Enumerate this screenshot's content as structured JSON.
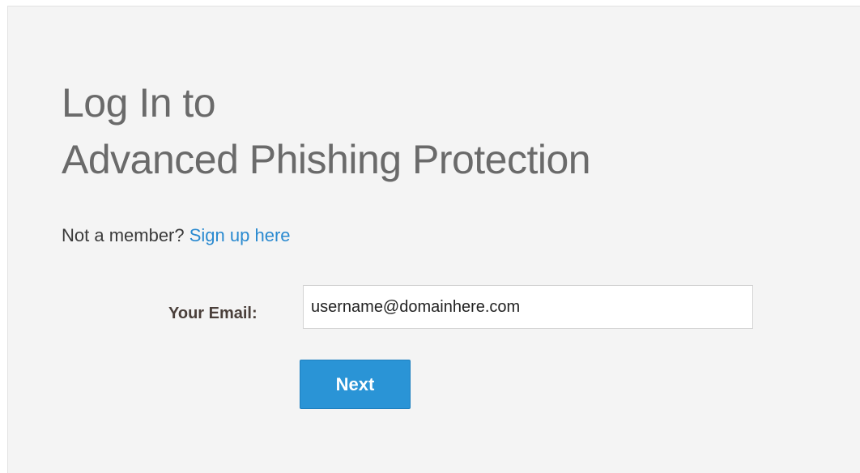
{
  "login": {
    "title_line1": "Log In to",
    "title_line2": "Advanced Phishing Protection",
    "not_member_text": "Not a member?",
    "signup_link": "Sign up here",
    "email_label": "Your Email:",
    "email_value": "username@domainhere.com",
    "next_label": "Next"
  },
  "colors": {
    "background": "#f4f4f4",
    "title": "#6a6a6a",
    "link": "#2a8ad0",
    "button": "#2a94d6",
    "button_text": "#ffffff"
  }
}
